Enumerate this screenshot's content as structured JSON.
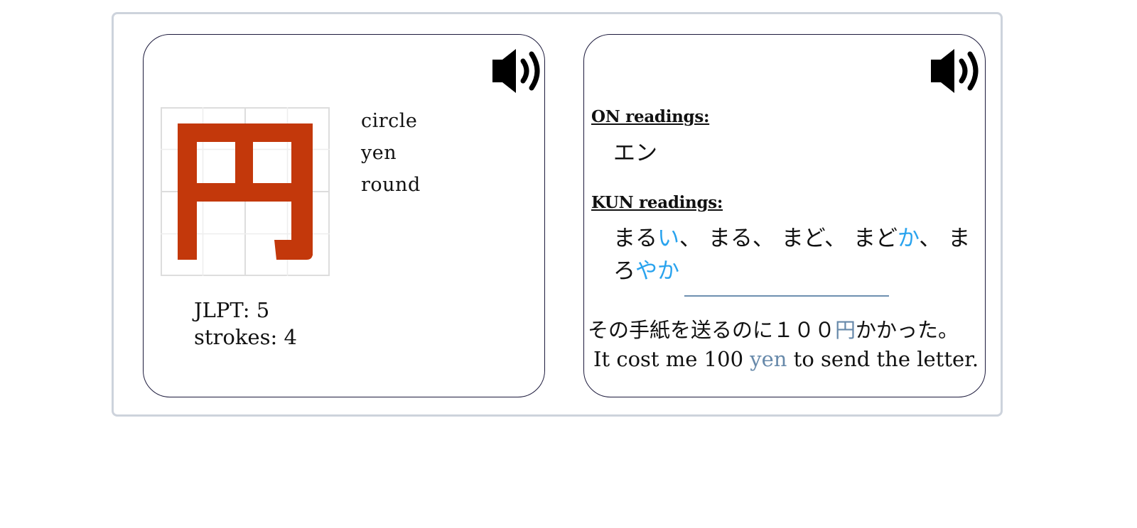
{
  "kanji_card": {
    "character": "円",
    "meanings": [
      "circle",
      "yen",
      "round"
    ],
    "jlpt_label": "JLPT: 5",
    "strokes_label": "strokes: 4"
  },
  "readings_card": {
    "on_heading": "ON readings:",
    "on_readings": "エン",
    "kun_heading": "KUN readings:",
    "kun_line1": [
      {
        "text": "まる",
        "highlight": false
      },
      {
        "text": "い",
        "highlight": true
      },
      {
        "text": "、 まる、 まど、 まど",
        "highlight": false
      },
      {
        "text": "か",
        "highlight": true
      },
      {
        "text": "、 ま",
        "highlight": false
      }
    ],
    "kun_line2": [
      {
        "text": "ろ",
        "highlight": false
      },
      {
        "text": "やか",
        "highlight": true
      }
    ],
    "example_jp": {
      "before": "その手紙を送るのに１００",
      "target": "円",
      "after": "かかった。"
    },
    "example_en": {
      "before": "It cost me 100 ",
      "target": "yen",
      "after": " to send the letter."
    }
  },
  "icons": {
    "speaker_left": "speaker-icon",
    "speaker_right": "speaker-icon"
  },
  "colors": {
    "kanji_fill": "#c3380b",
    "kun_highlight": "#29a3ee",
    "example_highlight": "#6789aa",
    "frame_border": "#cdd3dc",
    "card_border": "#1c1a3c"
  }
}
